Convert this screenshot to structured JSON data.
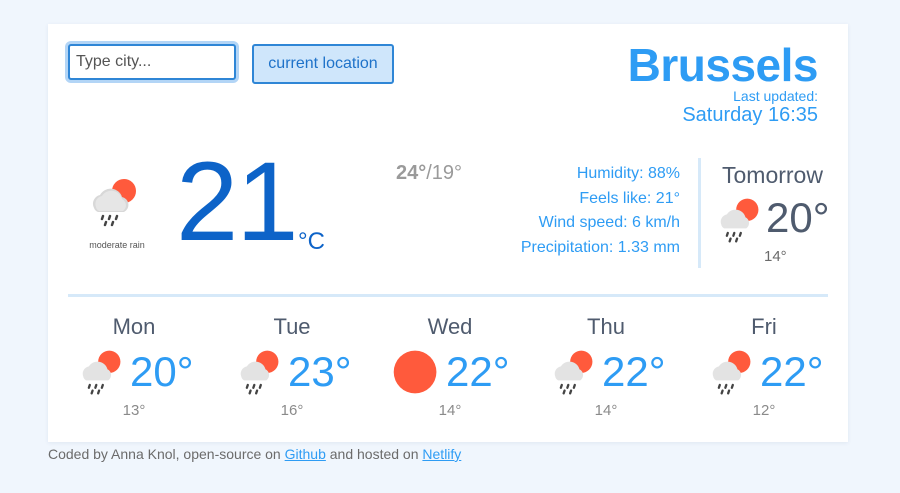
{
  "search": {
    "placeholder": "Type city...",
    "value": "",
    "location_label": "current location"
  },
  "header": {
    "city": "Brussels",
    "last_updated_label": "Last updated:",
    "last_updated_time": "Saturday 16:35"
  },
  "current": {
    "icon": "rain-cloud-sun-icon",
    "description": "moderate rain",
    "temp": "21",
    "unit": "°C",
    "high": "24°",
    "low": "/19°",
    "humidity": "Humidity: 88%",
    "feels_like": "Feels like: 21°",
    "wind": "Wind speed: 6 km/h",
    "precipitation": "Precipitation: 1.33 mm"
  },
  "tomorrow": {
    "label": "Tomorrow",
    "icon": "rain-cloud-sun-icon",
    "temp": "20°",
    "low": "14°"
  },
  "forecast": [
    {
      "day": "Mon",
      "icon": "rain-cloud-sun-icon",
      "temp": "20°",
      "low": "13°"
    },
    {
      "day": "Tue",
      "icon": "rain-cloud-sun-icon",
      "temp": "23°",
      "low": "16°"
    },
    {
      "day": "Wed",
      "icon": "sun-icon",
      "temp": "22°",
      "low": "14°"
    },
    {
      "day": "Thu",
      "icon": "rain-cloud-sun-icon",
      "temp": "22°",
      "low": "14°"
    },
    {
      "day": "Fri",
      "icon": "rain-cloud-sun-icon",
      "temp": "22°",
      "low": "12°"
    }
  ],
  "footer": {
    "prefix": "Coded by Anna Knol, open-source on ",
    "github": "Github",
    "middle": " and hosted on ",
    "netlify": "Netlify"
  },
  "colors": {
    "accent": "#2e9cf4",
    "temp_main": "#0d63c8",
    "sun": "#ff5a3c",
    "slate": "#4f5b6e"
  }
}
